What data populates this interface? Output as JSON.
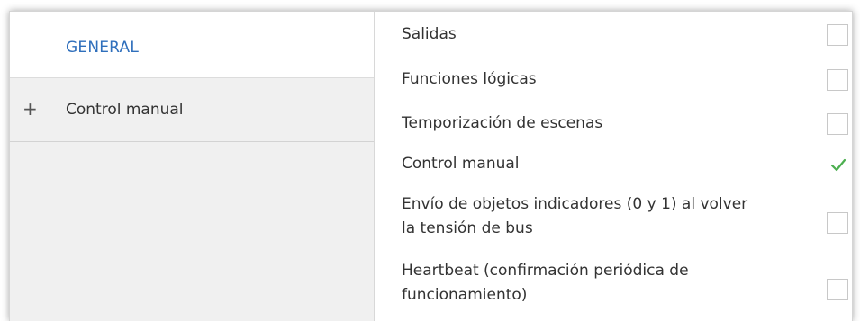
{
  "sidebar": {
    "general_label": "GENERAL",
    "items": [
      {
        "expander": "+",
        "label": "Control manual"
      }
    ]
  },
  "options": [
    {
      "label": "Salidas",
      "checked": false
    },
    {
      "label": "Funciones lógicas",
      "checked": false
    },
    {
      "label": "Temporización de escenas",
      "checked": false
    },
    {
      "label": "Control manual",
      "checked": true
    },
    {
      "label_line1": "Envío de objetos indicadores (0 y 1) al volver",
      "label_line2": "la tensión de bus",
      "checked": false
    },
    {
      "label_line1": "Heartbeat (confirmación periódica de",
      "label_line2": "funcionamiento)",
      "checked": false
    }
  ],
  "colors": {
    "accent": "#2f6fbc",
    "check": "#4caf50",
    "sidebar_bg": "#f0f0f0"
  },
  "icons": {
    "expand": "plus-icon",
    "check": "checkmark-icon"
  }
}
